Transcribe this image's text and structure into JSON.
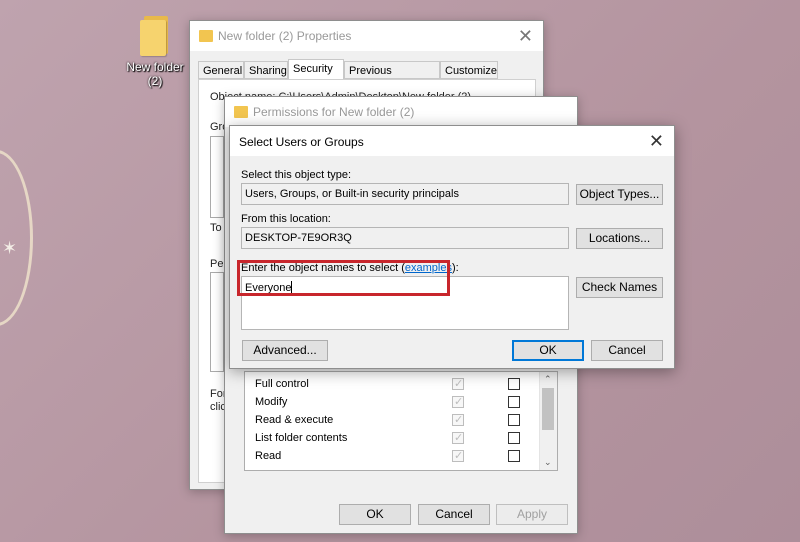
{
  "desktop": {
    "icon_label_line1": "New folder",
    "icon_label_line2": "(2)"
  },
  "properties_window": {
    "title": "New folder (2) Properties",
    "tabs": [
      "General",
      "Sharing",
      "Security",
      "Previous Versions",
      "Customize"
    ],
    "active_tab": "Security",
    "object_name_clip": "Object name:   C:\\Users\\Admin\\Desktop\\New folder (2)",
    "groups_clip": "Gro",
    "to_clip": "To",
    "pe_clip": "Pe",
    "for_clip": "For",
    "cli_clip": "clic",
    "buttons": {
      "ok": "OK",
      "cancel": "Cancel",
      "apply": "Apply"
    }
  },
  "permissions_window": {
    "title": "Permissions for New folder (2)",
    "rows": [
      {
        "label": "Full control",
        "allow": true,
        "deny": false
      },
      {
        "label": "Modify",
        "allow": true,
        "deny": false
      },
      {
        "label": "Read & execute",
        "allow": true,
        "deny": false
      },
      {
        "label": "List folder contents",
        "allow": true,
        "deny": false
      },
      {
        "label": "Read",
        "allow": true,
        "deny": false
      }
    ]
  },
  "select_dialog": {
    "title": "Select Users or Groups",
    "object_type_label": "Select this object type:",
    "object_type_value": "Users, Groups, or Built-in security principals",
    "object_types_button": "Object Types...",
    "location_label": "From this location:",
    "location_value": "DESKTOP-7E9OR3Q",
    "locations_button": "Locations...",
    "names_label_prefix": "Enter the object names to select (",
    "names_label_link": "examples",
    "names_label_suffix": "):",
    "names_value": "Everyone",
    "check_names_button": "Check Names",
    "advanced_button": "Advanced...",
    "ok_button": "OK",
    "cancel_button": "Cancel"
  },
  "colors": {
    "highlight": "#c8262c",
    "accent": "#0078d7",
    "desktop": "#b89ca8"
  }
}
